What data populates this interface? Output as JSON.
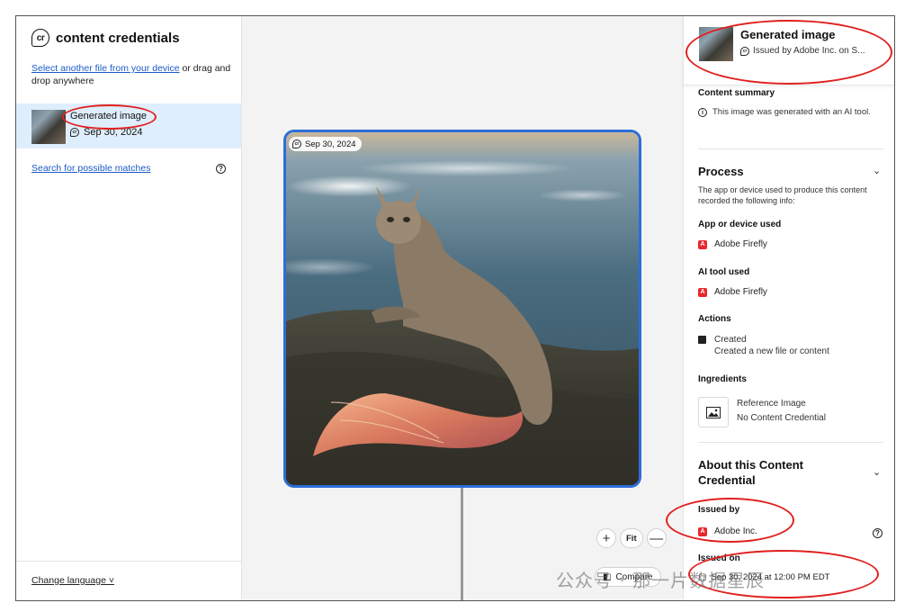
{
  "left": {
    "brand_logo": "cr",
    "brand_text": "content credentials",
    "select_link": "Select another file from your device",
    "select_tail": " or drag and drop anywhere",
    "file": {
      "title": "Generated image",
      "date": "Sep 30, 2024"
    },
    "search_link": "Search for possible matches",
    "change_language": "Change language ˅"
  },
  "center": {
    "badge_date": "Sep 30, 2024",
    "zoom": {
      "plus": "+",
      "fit": "Fit",
      "minus": "—"
    },
    "compare_label": "Compare"
  },
  "right": {
    "title": "Generated image",
    "issuer_line": "Issued by Adobe Inc. on S...",
    "content_summary": {
      "heading": "Content summary",
      "text": "This image was generated with an AI tool."
    },
    "process": {
      "heading": "Process",
      "desc": "The app or device used to produce this content recorded the following info:",
      "app_heading": "App or device used",
      "app_value": "Adobe Firefly",
      "ai_heading": "AI tool used",
      "ai_value": "Adobe Firefly",
      "actions_heading": "Actions",
      "action_title": "Created",
      "action_desc": "Created a new file or content",
      "ingredients_heading": "Ingredients",
      "ingredient_title": "Reference Image",
      "ingredient_desc": "No Content Credential"
    },
    "about": {
      "heading": "About this Content Credential",
      "issued_by_heading": "Issued by",
      "issued_by_value": "Adobe Inc.",
      "issued_on_heading": "Issued on",
      "issued_on_value": "Sep 30, 2024 at 12:00 PM EDT"
    }
  },
  "watermark": "公众号 · 那一片数据星辰",
  "colors": {
    "accent_blue": "#2b6ed8",
    "annotation_red": "#e0201f",
    "selection_bg": "#dfeefc",
    "adobe_red": "#e8272d"
  }
}
